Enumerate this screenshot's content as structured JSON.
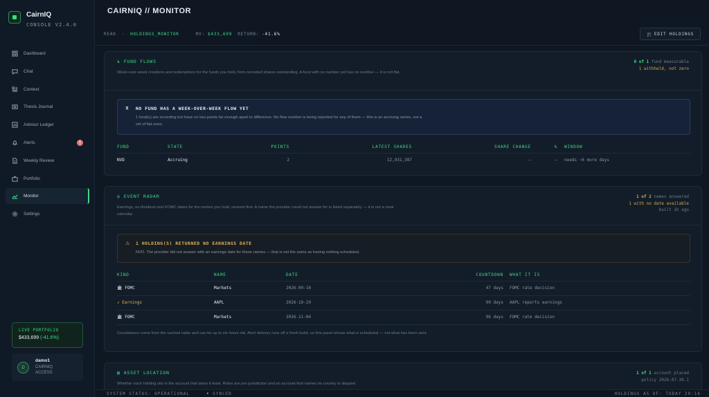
{
  "app": {
    "name": "CairnIQ",
    "version": "CONSOLE V2.4.0"
  },
  "sidebar": {
    "items": [
      {
        "label": "Dashboard",
        "icon": "grid-icon"
      },
      {
        "label": "Chat",
        "icon": "chat-icon"
      },
      {
        "label": "Context",
        "icon": "context-icon"
      },
      {
        "label": "Thesis Journal",
        "icon": "journal-icon"
      },
      {
        "label": "Advisor Ledger",
        "icon": "ledger-icon"
      },
      {
        "label": "Alerts",
        "icon": "bell-icon",
        "badge": "1"
      },
      {
        "label": "Weekly Review",
        "icon": "document-icon"
      },
      {
        "label": "Portfolio",
        "icon": "briefcase-icon"
      },
      {
        "label": "Monitor",
        "icon": "monitor-icon",
        "active": true
      },
      {
        "label": "Settings",
        "icon": "gear-icon"
      }
    ],
    "live_portfolio": {
      "label": "LIVE PORTFOLIO",
      "value": "$433,699",
      "return": "(-41.6%)"
    },
    "user": {
      "initial": "D",
      "name": "damo1",
      "role_line1": "CAIRNIQ",
      "role_line2": "ACCESS"
    }
  },
  "header": {
    "title": "CAIRNIQ // MONITOR",
    "mode": "READ",
    "view": "HOLDINGS_MONITOR",
    "mv_label": "MV:",
    "mv_value": "$433,699",
    "return_label": "RETURN:",
    "return_value": "-41.6%",
    "edit_button": "EDIT HOLDINGS"
  },
  "fund_flows": {
    "title": "FUND FLOWS",
    "description": "Week-over-week creations and redemptions for the funds you hold, from recorded shares outstanding. A fund with no number yet has no number — it is not flat.",
    "meta_count": "0 of 1",
    "meta_count_suffix": "fund measurable",
    "meta_withheld": "1 withheld, not zero",
    "notice_title": "NO FUND HAS A WEEK-OVER-WEEK FLOW YET",
    "notice_body": "1 fund(s) are recording but have no two points far enough apart to difference. No flow number is being reported for any of them — this is an accruing series, not a set of flat ones.",
    "columns": [
      "FUND",
      "STATE",
      "POINTS",
      "LATEST SHARES",
      "SHARE CHANGE",
      "%",
      "WINDOW"
    ],
    "rows": [
      {
        "fund": "NVD",
        "state": "Accruing",
        "points": "2",
        "latest_shares": "12,931,387",
        "share_change": "—",
        "pct": "—",
        "window": "needs ~6 more days"
      }
    ]
  },
  "event_radar": {
    "title": "EVENT RADAR",
    "description": "Earnings, ex-dividend and FOMC dates for the names you hold, nearest first. A name the provider could not answer for is listed separately — it is not a clear calendar.",
    "meta_count": "1 of 2",
    "meta_count_suffix": "names answered",
    "meta_missing": "1 with no date available",
    "meta_built": "built 1h ago",
    "notice_title": "1 HOLDING(S) RETURNED NO EARNINGS DATE",
    "notice_body": "NVD. The provider did not answer with an earnings date for these names — that is not the same as having nothing scheduled.",
    "columns": [
      "KIND",
      "NAME",
      "DATE",
      "COUNTDOWN",
      "WHAT IT IS"
    ],
    "rows": [
      {
        "kind": "FOMC",
        "kind_icon": "bank-icon",
        "name": "Markets",
        "date": "2026-09-16",
        "countdown": "47 days",
        "what": "FOMC rate decision"
      },
      {
        "kind": "Earnings",
        "kind_icon": "trend-icon",
        "name": "AAPL",
        "date": "2026-10-29",
        "countdown": "90 days",
        "what": "AAPL reports earnings"
      },
      {
        "kind": "FOMC",
        "kind_icon": "bank-icon",
        "name": "Markets",
        "date": "2026-11-04",
        "countdown": "96 days",
        "what": "FOMC rate decision"
      }
    ],
    "footnote": "Countdowns come from the cached radar and can be up to six hours old. Alert delivery runs off a fresh build, so this panel shows what is scheduled — not what has been sent."
  },
  "asset_location": {
    "title": "ASSET LOCATION",
    "description": "Whether each holding sits in the account that taxes it least. Rules are per jurisdiction and an account that names no country is skipped.",
    "meta_count": "1 of 1",
    "meta_count_suffix": "account placed",
    "meta_policy": "policy 2026-07-30.1"
  },
  "status": {
    "system": "SYSTEM STATUS: OPERATIONAL",
    "synced": "SYNCED",
    "holdings_asof": "HOLDINGS AS OF: TODAY 20:16"
  }
}
